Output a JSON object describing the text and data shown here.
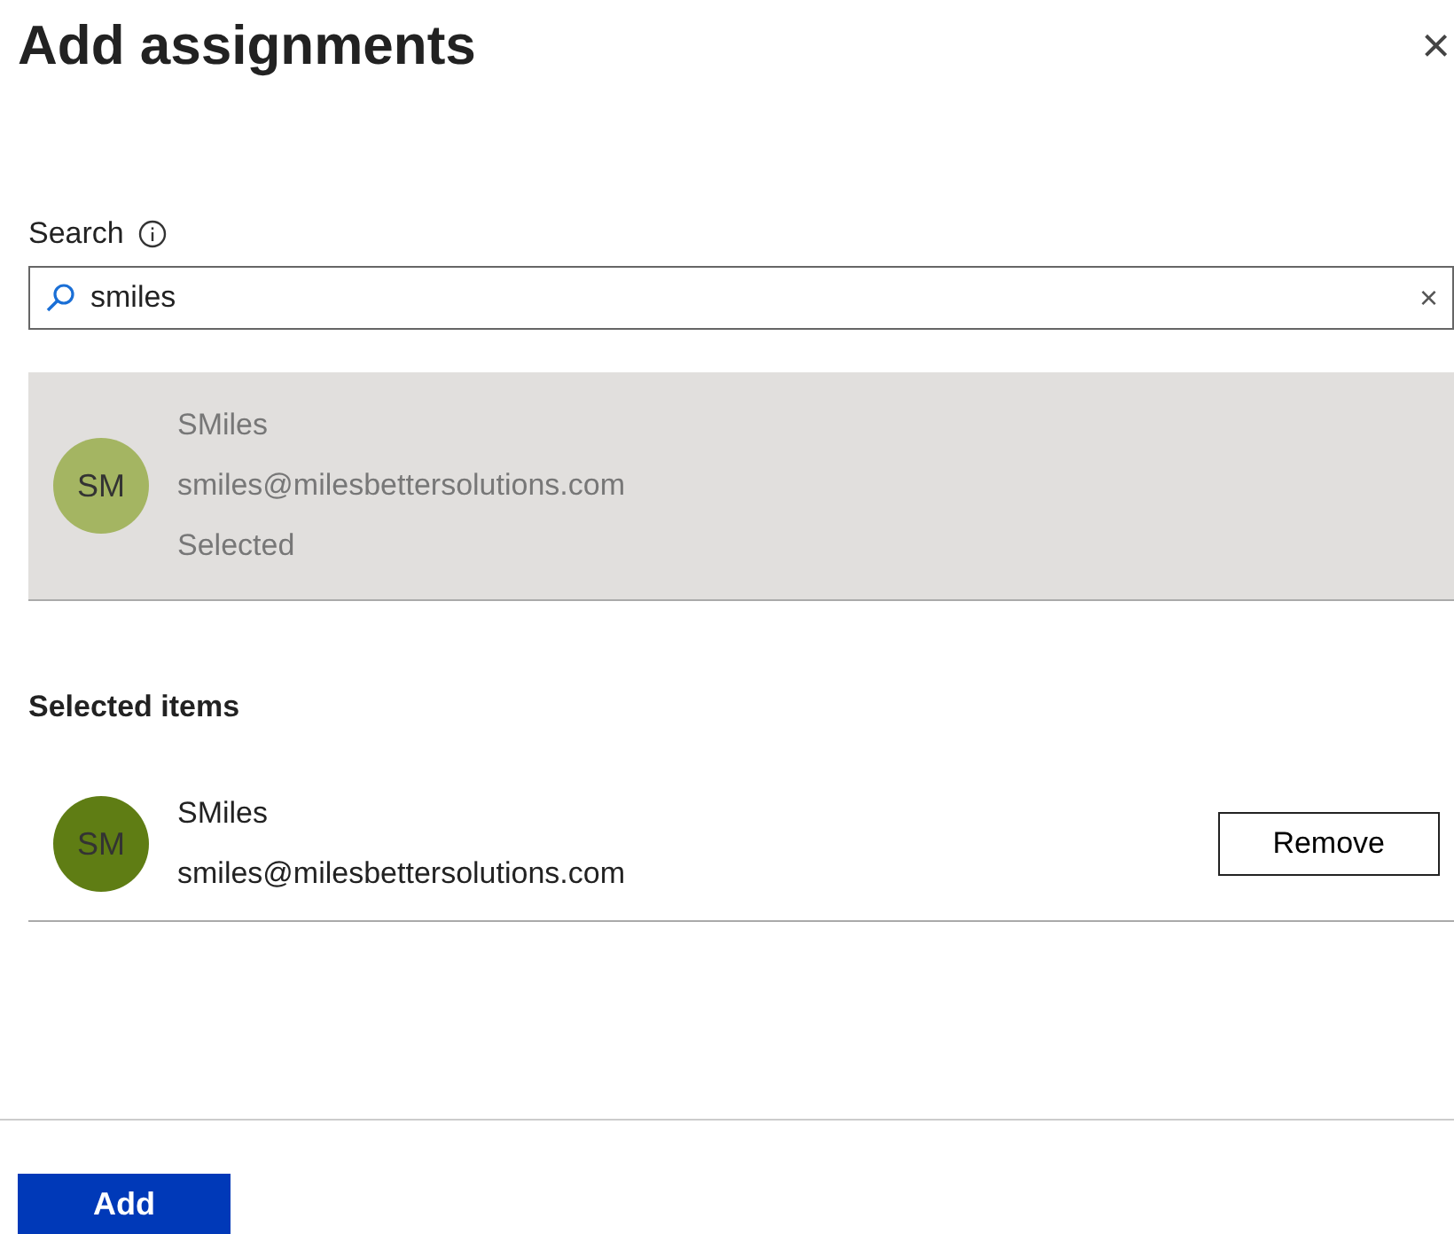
{
  "panel": {
    "title": "Add assignments",
    "close": "×"
  },
  "search": {
    "label": "Search",
    "value": "smiles",
    "clear": "×"
  },
  "results": [
    {
      "initials": "SM",
      "color": "#a4b562",
      "name": "SMiles",
      "email": "smiles@milesbettersolutions.com",
      "status": "Selected",
      "selected": true
    }
  ],
  "selected_items": {
    "heading": "Selected items",
    "items": [
      {
        "initials": "SM",
        "color": "#5f7d14",
        "name": "SMiles",
        "email": "smiles@milesbettersolutions.com",
        "action": "Remove"
      }
    ]
  },
  "footer": {
    "buttons": [
      "Add"
    ]
  }
}
